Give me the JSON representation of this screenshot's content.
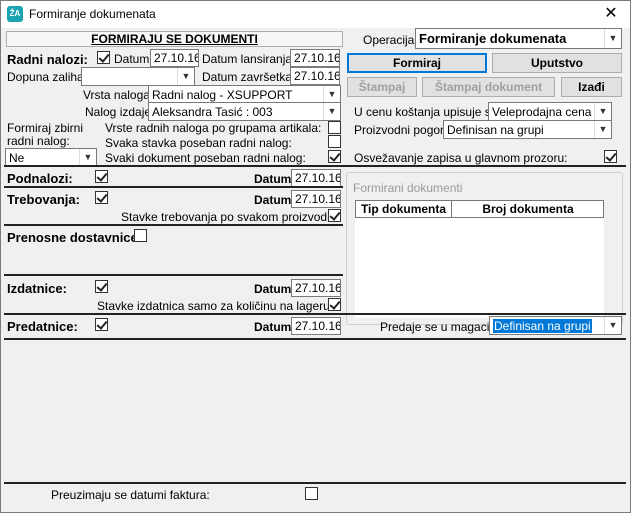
{
  "window": {
    "title": "Formiranje dokumenata",
    "app_icon_text": "ŽA",
    "close_glyph": "✕"
  },
  "form_header_button": "FORMIRAJU SE DOKUMENTI",
  "radni_nalozi": {
    "label": "Radni nalozi:",
    "checked": true,
    "datum_label": "Datum:",
    "datum_value": "27.10.16",
    "datum_lansiranja_label": "Datum lansiranja:",
    "datum_lansiranja_value": "27.10.16",
    "dopuna_label": "Dopuna zaliha:",
    "dopuna_value": "",
    "datum_zavrsetka_label": "Datum završetka:",
    "datum_zavrsetka_value": "27.10.16",
    "vrsta_label": "Vrsta naloga:",
    "vrsta_value": "Radni nalog - XSUPPORT",
    "nalog_izdaje_label": "Nalog izdaje:",
    "nalog_izdaje_value": "Aleksandra Tasić : 003",
    "zbirni_label_1": "Formiraj zbirni",
    "zbirni_label_2": "radni nalog:",
    "zbirni_value": "Ne",
    "opt1_label": "Vrste radnih naloga po grupama artikala:",
    "opt1_checked": false,
    "opt2_label": "Svaka stavka poseban radni nalog:",
    "opt2_checked": false,
    "opt3_label": "Svaki dokument poseban radni nalog:",
    "opt3_checked": true
  },
  "operacija": {
    "label": "Operacija:",
    "value": "Formiranje dokumenata"
  },
  "buttons": {
    "formiraj": "Formiraj",
    "uputstvo": "Uputstvo",
    "stampaj": "Štampaj",
    "stampaj_dokument": "Štampaj dokument",
    "izadji": "Izađi"
  },
  "cena": {
    "label": "U cenu koštanja upisuje se:",
    "value": "Veleprodajna cena"
  },
  "pogon": {
    "label": "Proizvodni pogon:",
    "value": "Definisan na grupi"
  },
  "osvezavanje": {
    "label": "Osvežavanje zapisa u glavnom prozoru:",
    "checked": true
  },
  "podnalozi": {
    "label": "Podnalozi:",
    "checked": true,
    "datum_label": "Datum:",
    "datum_value": "27.10.16"
  },
  "trebovanja": {
    "label": "Trebovanja:",
    "checked": true,
    "datum_label": "Datum:",
    "datum_value": "27.10.16",
    "stavke_label": "Stavke trebovanja po svakom proizvodu:",
    "stavke_checked": true
  },
  "prenosne": {
    "label": "Prenosne dostavnice:",
    "checked": false
  },
  "izdatnice": {
    "label": "Izdatnice:",
    "checked": true,
    "datum_label": "Datum:",
    "datum_value": "27.10.16",
    "stavke_label": "Stavke izdatnica samo za količinu na lageru:",
    "stavke_checked": true
  },
  "predatnice": {
    "label": "Predatnice:",
    "checked": true,
    "datum_label": "Datum:",
    "datum_value": "27.10.16",
    "magacin_label": "Predaje se u magacin:",
    "magacin_value": "Definisan na grupi"
  },
  "formirani": {
    "title": "Formirani dokumenti",
    "columns": [
      "Tip dokumenta",
      "Broj dokumenta"
    ],
    "rows": []
  },
  "faktura": {
    "label": "Preuzimaju se datumi faktura:",
    "checked": false
  },
  "colors": {
    "accent": "#0078d7",
    "icon": "#1aa3b0"
  }
}
